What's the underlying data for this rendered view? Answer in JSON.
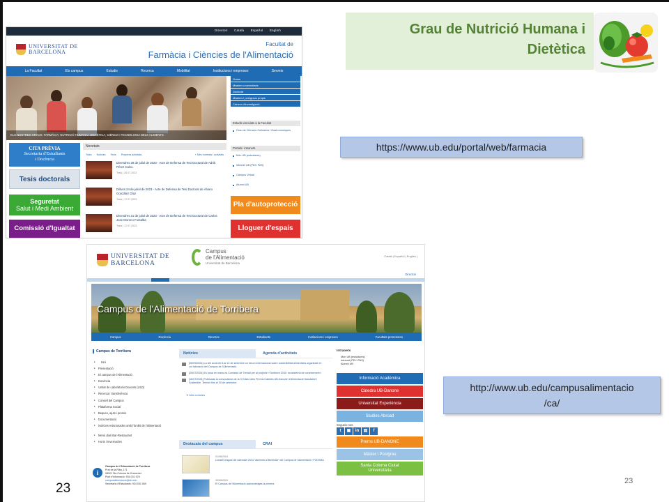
{
  "slide": {
    "title_line1": "Grau de Nutrició Humana i",
    "title_line2": "Dietètica",
    "url1": "https://www.ub.edu/portal/web/farmacia",
    "url2_line1": "http://www.ub.edu/campusalimentacio",
    "url2_line2": "/ca/",
    "page_number_left": "23",
    "page_number_right": "23"
  },
  "shot1": {
    "top_links": [
      "Directori",
      "Català",
      "Español",
      "English"
    ],
    "university_line1": "UNIVERSITAT DE",
    "university_line2": "BARCELONA",
    "faculty_small": "Facultat de",
    "faculty_big": "Farmàcia i Ciències de l'Alimentació",
    "nav": [
      "La Facultat",
      "Els campus",
      "Estudis",
      "Recerca",
      "Mobilitat",
      "Institucions i empreses",
      "Serveis"
    ],
    "hero_caption": "ELS NOSTRES GRAUS: FARMÀCIA, NUTRICIÓ HUMANA I DIETÈTICA, CIÈNCIA I TECNOLOGIA DELS ALIMENTS",
    "right_menu": [
      "Graus",
      "Màsters universitaris",
      "Doctorat",
      "Màsters i postgraus propis",
      "Carrera d'investigació"
    ],
    "linked_studies_title": "Estudis vinculats a la Facultat",
    "linked_studies": [
      "Grau de Ciències Culinàries i Gastronòmiques"
    ],
    "portals_title": "Portals i intranets",
    "portals": [
      "Món UB (estudiants)",
      "Intranet UB (PDI i PAS)",
      "Campus Virtual",
      "Alumni UB"
    ],
    "btn_secretaria_line1": "CITA PRÈVIA",
    "btn_secretaria_line2": "Secretaria d'Estudiants",
    "btn_secretaria_line3": "i Docència",
    "btn_tesis": "Tesis doctorals",
    "btn_seguretat_line1": "Seguretat",
    "btn_seguretat_line2": "Salut i Medi Ambient",
    "btn_igualtat": "Comissió d'Igualtat",
    "btn_autoproteccio": "Pla d'autoprotecció",
    "btn_lloguer": "Lloguer d'espais",
    "news_heading": "Novetats",
    "news_tabs": [
      "Totes",
      "Notícies",
      "Tesis",
      "Properes activitats"
    ],
    "news_more": "+ Més novetats i activitats",
    "news": [
      {
        "title": "Divendres 28 de juliol de 2023 - Acte de Defensa de Tesi Doctoral de Adrià Pérez Calvo.",
        "date": "Tesis | 25.07.2023"
      },
      {
        "title": "Dilluns 24 de juliol de 2023 - Acte de Defensa de Tesi Doctoral de Àlvaro González Díaz",
        "date": "Tesis | 17.07.2023"
      },
      {
        "title": "Divendres 21 de juliol de 2023 - Acte de Defensa de Tesi Doctoral de Carlos Jose Moreno Fontalba",
        "date": "Tesis | 17.07.2023"
      }
    ]
  },
  "shot2": {
    "university_line1": "UNIVERSITAT DE",
    "university_line2": "BARCELONA",
    "campus_line1": "Campus",
    "campus_line2": "de l'Alimentació",
    "campus_line3": "Universitat de Barcelona",
    "langs": "Català | Español | English |",
    "directori": "Directori",
    "banner_title": "Campus de l'Alimentació de Torribera",
    "nav": [
      "Campus",
      "Docència",
      "Recerca",
      "Estudiants",
      "Institucions i empreses",
      "Facultats promotores"
    ],
    "left_title": "Campus de Torribera",
    "left_items": [
      "Inici",
      "Presentació",
      "El campus de l'Alimentació",
      "Docència",
      "Unitat de Laboratoris Docents (ULD)",
      "Recerca i transferència",
      "Consell del Campus",
      "Plataforma Social",
      "Beques, ajuts i premis",
      "Documentació",
      "Notícies relacionades amb l'àmbit de l'alimentació",
      "Menú diari Bar-Restaurant",
      "Horts i Invernacles"
    ],
    "contact_line1": "Campus de l'Alimentació de Torribera",
    "contact_line2": "Prat de la Riba, 171",
    "contact_line3": "08921 Sta Coloma de Gramenet",
    "contact_line4": "Punt d'informació: 934 031 978",
    "contact_line5": "campusalimentacio@ub.edu",
    "contact_line6": "Secretaria d'Estudiants: 934 031 060",
    "tab_noticies": "Notícies",
    "tab_agenda": "Agenda d'activitats",
    "news": [
      "[06/09/2024] La UB acull del 8 al 12 de setembre un fòrum internacional sobre sostenibilitat alimentària organitzat en col·laboració del Campus de l'Alimentació.",
      "[25/07/2024] Es posa en marxa la Comissió de Treball per al projecte «Torribera 2030: ecosistema de coneixement».",
      "[16/07/2024] Publicada la convocatòria de la X Edició dels Premis Càtedra UB-Danone d'Alimentació Saludable i Sostenible. Termini fins el 30 de setembre."
    ],
    "more_news": "Més notícies",
    "tab_destacats": "Destacats del campus",
    "tab_crai": "CRAI",
    "destacats": [
      {
        "date": "01/08/2024",
        "text": "Consell d'agost del calendari 2024 \"Aliments al Benestar\" del Campus de l'Alimentació i FODSMA"
      },
      {
        "date": "30/06/2024",
        "text": "El Campus de l'Alimentació acknowledges la primera"
      }
    ],
    "intranets_title": "Intranets",
    "intranets": [
      "Món UB (estudiants)",
      "Intranet (PDI i PAS)",
      "Alumni UB"
    ],
    "btn_info": "Informació Acadèmica",
    "btn_danone": "Càtedra UB-Danone",
    "btn_experiencia": "Universitat Experiència",
    "btn_abroad": "Studies Abroad",
    "seguens": "Segueix-nos",
    "social": [
      "t",
      "▣",
      "in",
      "▤",
      "f"
    ],
    "btn_prems": "Prems UB-DANONE",
    "btn_master": "Màster i Postgrau",
    "btn_santa_line1": "Santa Coloma Ciutat",
    "btn_santa_line2": "Universitària"
  }
}
